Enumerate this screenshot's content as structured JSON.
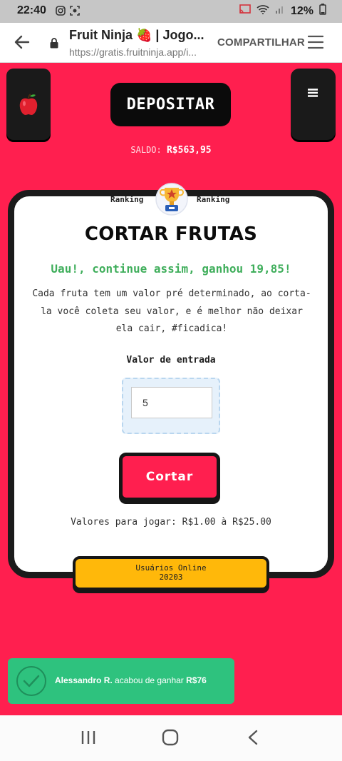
{
  "status_bar": {
    "time": "22:40",
    "battery": "12%",
    "icons": [
      "instagram-icon",
      "screenshot-icon",
      "cast-icon",
      "wifi-icon",
      "signal-icon",
      "battery-icon"
    ]
  },
  "browser": {
    "title": "Fruit Ninja 🍓 | Jogo...",
    "url": "https://gratis.fruitninja.app/i...",
    "share_label": "COMPARTILHAR"
  },
  "header": {
    "deposit_label": "DEPOSITAR",
    "balance_label": "SALDO:",
    "balance_value": "R$563,95"
  },
  "card": {
    "ranking_left": "Ranking",
    "ranking_right": "Ranking",
    "title": "CORTAR FRUTAS",
    "win_message": "Uau!, continue assim, ganhou 19,85!",
    "description": "Cada fruta tem um valor pré determinado, ao corta-la você coleta seu valor, e é melhor não deixar ela cair, #ficadica!",
    "entry_label": "Valor de entrada",
    "entry_value": "5",
    "cut_button": "Cortar",
    "range_text": "Valores para jogar: R$1.00 à R$25.00"
  },
  "online": {
    "label": "Usuários Online",
    "count": "20203"
  },
  "toast": {
    "name": "Alessandro R.",
    "text": "acabou de ganhar",
    "amount": "R$76"
  },
  "colors": {
    "background": "#ff1f4f",
    "accent_green": "#3fae5b",
    "toast_green": "#2ec27e",
    "online_yellow": "#ffb80a",
    "dark": "#1b1b1b"
  }
}
